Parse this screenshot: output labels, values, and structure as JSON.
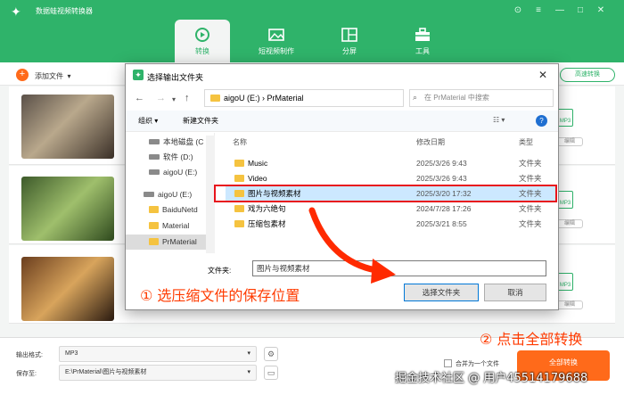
{
  "app": {
    "title": "数据蛙视频转换器",
    "nav": [
      {
        "label": "转换",
        "icon": "convert-icon"
      },
      {
        "label": "短视频制作",
        "icon": "image-icon"
      },
      {
        "label": "分屏",
        "icon": "split-screen-icon"
      },
      {
        "label": "工具",
        "icon": "toolbox-icon"
      }
    ],
    "add_file": "添加文件",
    "speed_btn": "高速转换",
    "edit_label": "编辑",
    "mp3_label": "MP3",
    "output_format_label": "输出格式:",
    "output_format_value": "MP3",
    "save_to_label": "保存至:",
    "save_to_value": "E:\\PrMaterial\\图片与视频素材",
    "merge_label": "合并为一个文件",
    "convert_all": "全部转换"
  },
  "dialog": {
    "title": "选择输出文件夹",
    "breadcrumb": "aigoU (E:)  ›  PrMaterial",
    "search_placeholder": "在 PrMaterial 中搜索",
    "organize": "组织 ▾",
    "new_folder": "新建文件夹",
    "tree": [
      {
        "label": "本地磁盘 (C",
        "type": "drive"
      },
      {
        "label": "软件 (D:)",
        "type": "drive"
      },
      {
        "label": "aigoU (E:)",
        "type": "drive"
      },
      {
        "label": "aigoU (E:)",
        "type": "drive"
      },
      {
        "label": "BaiduNetd",
        "type": "folder"
      },
      {
        "label": "Material",
        "type": "folder"
      },
      {
        "label": "PrMaterial",
        "type": "folder"
      }
    ],
    "columns": {
      "name": "名称",
      "date": "修改日期",
      "type": "类型"
    },
    "files": [
      {
        "name": "Music",
        "date": "2025/3/26 9:43",
        "type": "文件夹"
      },
      {
        "name": "Video",
        "date": "2025/3/26 9:43",
        "type": "文件夹"
      },
      {
        "name": "图片与视频素材",
        "date": "2025/3/20 17:32",
        "type": "文件夹"
      },
      {
        "name": "戏为六绝句",
        "date": "2024/7/28 17:26",
        "type": "文件夹"
      },
      {
        "name": "压缩包素材",
        "date": "2025/3/21 8:55",
        "type": "文件夹"
      }
    ],
    "folder_label": "文件夹:",
    "folder_value": "图片与视频素材",
    "select_btn": "选择文件夹",
    "cancel_btn": "取消"
  },
  "annotations": {
    "step1": "① 选压缩文件的保存位置",
    "step2": "② 点击全部转换",
    "watermark": "掘金技术社区 @ 用户45514179688"
  },
  "colors": {
    "brand": "#2fb36a",
    "accent": "#ff6a1a",
    "highlight": "#e8141c"
  }
}
